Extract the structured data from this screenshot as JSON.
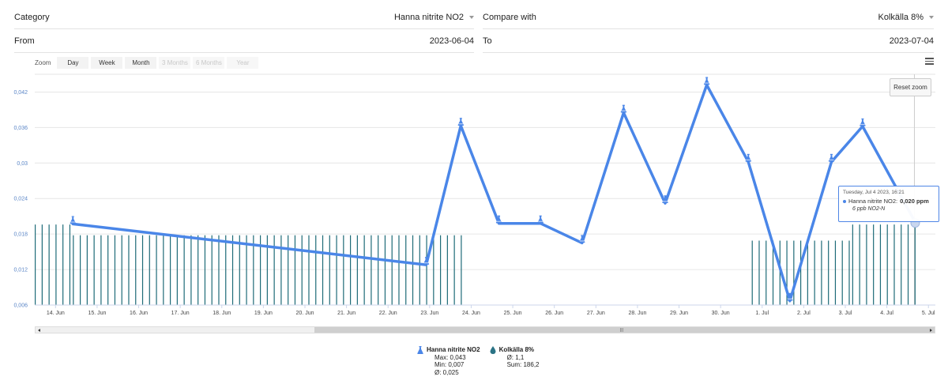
{
  "filters": {
    "category_label": "Category",
    "category_value": "Hanna nitrite NO2",
    "compare_label": "Compare with",
    "compare_value": "Kolkälla 8%",
    "from_label": "From",
    "from_value": "2023-06-04",
    "to_label": "To",
    "to_value": "2023-07-04"
  },
  "zoom": {
    "label": "Zoom",
    "buttons": [
      "Day",
      "Week",
      "Month",
      "3 Months",
      "6 Months",
      "Year"
    ],
    "disabled": [
      false,
      false,
      false,
      true,
      true,
      true
    ]
  },
  "reset_zoom_label": "Reset zoom",
  "tooltip": {
    "date": "Tuesday, Jul 4 2023, 16:21",
    "series": "Hanna nitrite NO2:",
    "value": "0,020 ppm",
    "sub": "6 ppb NO2-N"
  },
  "legend": [
    {
      "name": "Hanna nitrite NO2",
      "icon": "flask-icon",
      "stats": [
        "Max: 0,043",
        "Min: 0,007",
        "Ø: 0,025"
      ]
    },
    {
      "name": "Kolkälla 8%",
      "icon": "drop-icon",
      "stats": [
        "Ø: 1,1",
        "Sum: 186,2"
      ]
    }
  ],
  "colors": {
    "line": "#4a86e8",
    "bars": "#1e6b78",
    "marker": "#4a86e8"
  },
  "chart_data": {
    "type": "line",
    "x_start": "2023-06-13T12:00",
    "x_end": "2023-07-05T04:00",
    "ylim": [
      0.006,
      0.045
    ],
    "yticks": [
      "0,042",
      "0,036",
      "0,03",
      "0,024",
      "0,018",
      "0,012",
      "0,006"
    ],
    "yticks_values": [
      0.042,
      0.036,
      0.03,
      0.024,
      0.018,
      0.012,
      0.006
    ],
    "xticks": [
      "14. Jun",
      "15. Jun",
      "16. Jun",
      "17. Jun",
      "18. Jun",
      "19. Jun",
      "20. Jun",
      "21. Jun",
      "22. Jun",
      "23. Jun",
      "24. Jun",
      "25. Jun",
      "26. Jun",
      "27. Jun",
      "28. Jun",
      "29. Jun",
      "30. Jun",
      "1. Jul",
      "2. Jul",
      "3. Jul",
      "4. Jul",
      "5. Jul"
    ],
    "series": [
      {
        "name": "Hanna nitrite NO2",
        "points": [
          {
            "x": "2023-06-14T10:00",
            "y": 0.0197
          },
          {
            "x": "2023-06-22T22:00",
            "y": 0.0128
          },
          {
            "x": "2023-06-23T18:00",
            "y": 0.0363
          },
          {
            "x": "2023-06-24T16:00",
            "y": 0.0198
          },
          {
            "x": "2023-06-25T16:00",
            "y": 0.0198
          },
          {
            "x": "2023-06-26T16:00",
            "y": 0.0165
          },
          {
            "x": "2023-06-27T16:00",
            "y": 0.0385
          },
          {
            "x": "2023-06-28T16:00",
            "y": 0.0232
          },
          {
            "x": "2023-06-29T16:00",
            "y": 0.0432
          },
          {
            "x": "2023-06-30T16:00",
            "y": 0.0302
          },
          {
            "x": "2023-07-01T16:00",
            "y": 0.0067
          },
          {
            "x": "2023-07-02T16:00",
            "y": 0.0302
          },
          {
            "x": "2023-07-03T10:00",
            "y": 0.0362
          },
          {
            "x": "2023-07-04T16:21",
            "y": 0.02
          }
        ]
      },
      {
        "name": "Kolkälla 8%",
        "bar_segments": [
          {
            "from": "2023-06-13T12:00",
            "to": "2023-06-14T10:00",
            "value": 1.5
          },
          {
            "from": "2023-06-14T10:00",
            "to": "2023-06-23T20:00",
            "value": 1.3
          },
          {
            "from": "2023-06-30T18:00",
            "to": "2023-07-03T04:00",
            "value": 1.2
          },
          {
            "from": "2023-07-03T04:00",
            "to": "2023-07-04T18:00",
            "value": 1.5
          }
        ]
      }
    ]
  }
}
